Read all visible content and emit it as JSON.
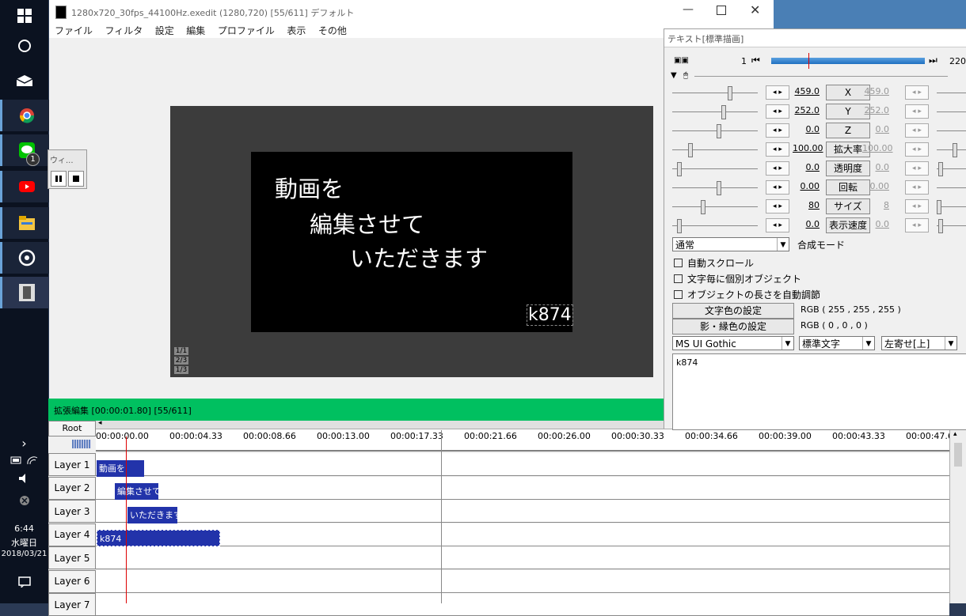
{
  "taskbar": {
    "time": "6:44",
    "day": "水曜日",
    "date": "2018/03/21",
    "badge": "1"
  },
  "main_window": {
    "title": "1280x720_30fps_44100Hz.exedit (1280,720)  [55/611]  デフォルト",
    "menu": [
      "ファイル",
      "フィルタ",
      "設定",
      "編集",
      "プロファイル",
      "表示",
      "その他"
    ],
    "video_lines": [
      "動画を",
      "編集させて",
      "いただきます"
    ],
    "watermark": "k874",
    "page_markers": [
      "1/1",
      "2/3",
      "1/3"
    ]
  },
  "mini_window": {
    "title": "ウィ..."
  },
  "timeline": {
    "header": "拡張編集 [00:00:01.80] [55/611]",
    "root": "Root",
    "ticks": [
      "00:00:00.00",
      "00:00:04.33",
      "00:00:08.66",
      "00:00:13.00",
      "00:00:17.33",
      "00:00:21.66",
      "00:00:26.00",
      "00:00:30.33",
      "00:00:34.66",
      "00:00:39.00",
      "00:00:43.33",
      "00:00:47.66"
    ],
    "layers": [
      "Layer 1",
      "Layer 2",
      "Layer 3",
      "Layer 4",
      "Layer 5",
      "Layer 6",
      "Layer 7"
    ],
    "clips": [
      {
        "label": "動画を"
      },
      {
        "label": "編集させて"
      },
      {
        "label": "いただきます"
      },
      {
        "label": "k874"
      }
    ]
  },
  "panel": {
    "title": "テキスト[標準描画]",
    "frame_start": "1",
    "frame_end": "220",
    "params": [
      {
        "value": "459.0",
        "label": "X",
        "value2": "459.0"
      },
      {
        "value": "252.0",
        "label": "Y",
        "value2": "252.0"
      },
      {
        "value": "0.0",
        "label": "Z",
        "value2": "0.0"
      },
      {
        "value": "100.00",
        "label": "拡大率",
        "value2": "100.00"
      },
      {
        "value": "0.0",
        "label": "透明度",
        "value2": "0.0"
      },
      {
        "value": "0.00",
        "label": "回転",
        "value2": "0.00"
      },
      {
        "value": "80",
        "label": "サイズ",
        "value2": "8"
      },
      {
        "value": "0.0",
        "label": "表示速度",
        "value2": "0.0"
      }
    ],
    "blend_select": "通常",
    "blend_label": "合成モード",
    "checkboxes": [
      "自動スクロール",
      "文字毎に個別オブジェクト",
      "オブジェクトの長さを自動調節"
    ],
    "text_color_btn": "文字色の設定",
    "text_color_value": "RGB ( 255 , 255 , 255 )",
    "shadow_color_btn": "影・縁色の設定",
    "shadow_color_value": "RGB ( 0 , 0 , 0 )",
    "font_select": "MS UI Gothic",
    "style_select": "標準文字",
    "align_select": "左寄せ[上]",
    "text_content": "k874"
  }
}
